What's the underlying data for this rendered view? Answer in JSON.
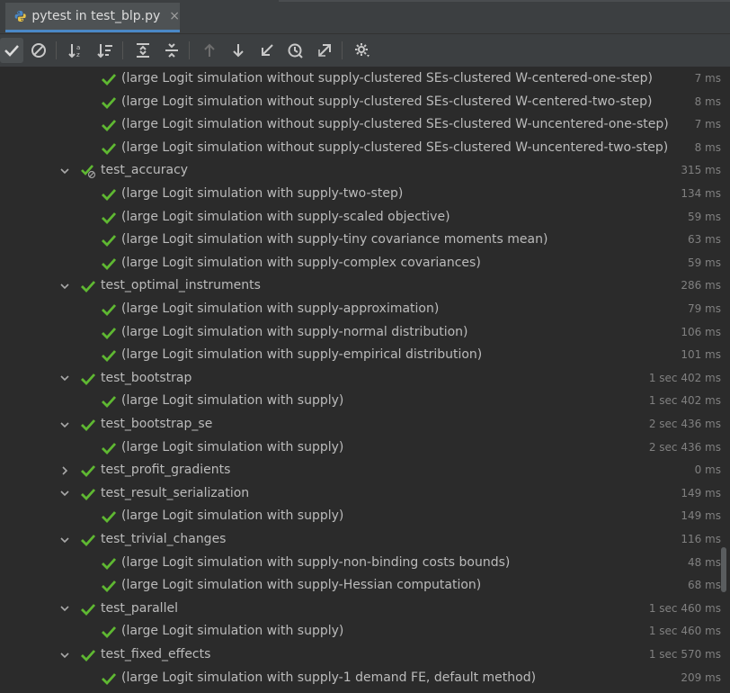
{
  "tab": {
    "title": "pytest in test_blp.py",
    "close_glyph": "×"
  },
  "toolbar": {
    "buttons": [
      {
        "name": "show-passed-button",
        "icon": "check-icon",
        "active": true
      },
      {
        "name": "show-ignored-button",
        "icon": "no-entry-icon"
      },
      {
        "name": "sort-alphabetically-button",
        "icon": "sort-alpha-icon"
      },
      {
        "name": "sort-by-duration-button",
        "icon": "sort-duration-icon"
      },
      {
        "name": "expand-all-button",
        "icon": "expand-all-icon"
      },
      {
        "name": "collapse-all-button",
        "icon": "collapse-all-icon"
      },
      {
        "name": "previous-failed-button",
        "icon": "arrow-up-icon"
      },
      {
        "name": "next-failed-button",
        "icon": "arrow-down-icon"
      },
      {
        "name": "import-tests-button",
        "icon": "import-icon"
      },
      {
        "name": "test-history-button",
        "icon": "history-icon"
      },
      {
        "name": "export-results-button",
        "icon": "export-icon"
      },
      {
        "name": "settings-button",
        "icon": "gear-icon"
      }
    ]
  },
  "colors": {
    "pass": "#5fb832",
    "text": "#bbbbbb",
    "time": "#808080",
    "background": "#2b2b2b"
  },
  "rows": [
    {
      "label": "(large Logit simulation without supply-clustered SEs-clustered W-centered-one-step)",
      "time": "7 ms",
      "level": 2
    },
    {
      "label": "(large Logit simulation without supply-clustered SEs-clustered W-centered-two-step)",
      "time": "8 ms",
      "level": 2
    },
    {
      "label": "(large Logit simulation without supply-clustered SEs-clustered W-uncentered-one-step)",
      "time": "7 ms",
      "level": 2
    },
    {
      "label": "(large Logit simulation without supply-clustered SEs-clustered W-uncentered-two-step)",
      "time": "8 ms",
      "level": 2
    },
    {
      "label": "test_accuracy",
      "time": "315 ms",
      "level": 1,
      "expanded": true,
      "status": "partial"
    },
    {
      "label": "(large Logit simulation with supply-two-step)",
      "time": "134 ms",
      "level": 2
    },
    {
      "label": "(large Logit simulation with supply-scaled objective)",
      "time": "59 ms",
      "level": 2
    },
    {
      "label": "(large Logit simulation with supply-tiny covariance moments mean)",
      "time": "63 ms",
      "level": 2
    },
    {
      "label": "(large Logit simulation with supply-complex covariances)",
      "time": "59 ms",
      "level": 2
    },
    {
      "label": "test_optimal_instruments",
      "time": "286 ms",
      "level": 1,
      "expanded": true
    },
    {
      "label": "(large Logit simulation with supply-approximation)",
      "time": "79 ms",
      "level": 2
    },
    {
      "label": "(large Logit simulation with supply-normal distribution)",
      "time": "106 ms",
      "level": 2
    },
    {
      "label": "(large Logit simulation with supply-empirical distribution)",
      "time": "101 ms",
      "level": 2
    },
    {
      "label": "test_bootstrap",
      "time": "1 sec 402 ms",
      "level": 1,
      "expanded": true
    },
    {
      "label": "(large Logit simulation with supply)",
      "time": "1 sec 402 ms",
      "level": 2
    },
    {
      "label": "test_bootstrap_se",
      "time": "2 sec 436 ms",
      "level": 1,
      "expanded": true
    },
    {
      "label": "(large Logit simulation with supply)",
      "time": "2 sec 436 ms",
      "level": 2
    },
    {
      "label": "test_profit_gradients",
      "time": "0 ms",
      "level": 1,
      "expanded": false
    },
    {
      "label": "test_result_serialization",
      "time": "149 ms",
      "level": 1,
      "expanded": true
    },
    {
      "label": "(large Logit simulation with supply)",
      "time": "149 ms",
      "level": 2
    },
    {
      "label": "test_trivial_changes",
      "time": "116 ms",
      "level": 1,
      "expanded": true
    },
    {
      "label": "(large Logit simulation with supply-non-binding costs bounds)",
      "time": "48 ms",
      "level": 2
    },
    {
      "label": "(large Logit simulation with supply-Hessian computation)",
      "time": "68 ms",
      "level": 2
    },
    {
      "label": "test_parallel",
      "time": "1 sec 460 ms",
      "level": 1,
      "expanded": true
    },
    {
      "label": "(large Logit simulation with supply)",
      "time": "1 sec 460 ms",
      "level": 2
    },
    {
      "label": "test_fixed_effects",
      "time": "1 sec 570 ms",
      "level": 1,
      "expanded": true
    },
    {
      "label": "(large Logit simulation with supply-1 demand FE, default method)",
      "time": "209 ms",
      "level": 2
    }
  ]
}
